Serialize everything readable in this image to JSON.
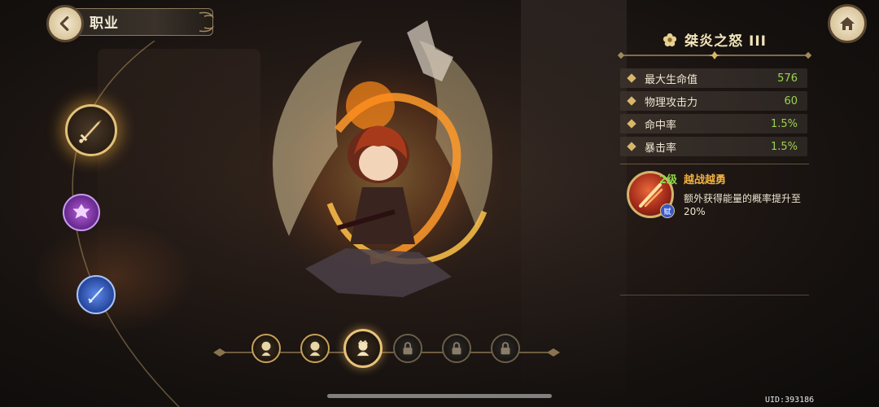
{
  "header": {
    "title": "职业",
    "back_icon": "back-arrow-icon",
    "home_icon": "home-icon"
  },
  "classes": [
    {
      "name": "sword-class",
      "icon": "sword-icon",
      "selected": true
    },
    {
      "name": "rune-class",
      "icon": "rune-icon",
      "selected": false
    },
    {
      "name": "blade-class",
      "icon": "blade-icon",
      "selected": false
    }
  ],
  "skill": {
    "name": "桀炎之怒 III",
    "icon": "flower-icon"
  },
  "stats": [
    {
      "label": "最大生命值",
      "value": "576"
    },
    {
      "label": "物理攻击力",
      "value": "60"
    },
    {
      "label": "命中率",
      "value": "1.5%"
    },
    {
      "label": "暴击率",
      "value": "1.5%"
    }
  ],
  "talent": {
    "level": "2级",
    "name": "越战越勇",
    "badge": "赋",
    "description": "额外获得能量的概率提升至20%"
  },
  "tiers": [
    {
      "state": "unlocked",
      "icon": "chibi-1-icon"
    },
    {
      "state": "unlocked",
      "icon": "chibi-2-icon"
    },
    {
      "state": "current",
      "icon": "chibi-3-icon"
    },
    {
      "state": "locked",
      "icon": "lock-icon"
    },
    {
      "state": "locked",
      "icon": "lock-icon"
    },
    {
      "state": "locked",
      "icon": "lock-icon"
    }
  ],
  "footer": {
    "uid": "UID:393186"
  },
  "colors": {
    "accent_gold": "#d9b76a",
    "stat_green": "#9ad44c",
    "talent_orange": "#f0b040"
  }
}
